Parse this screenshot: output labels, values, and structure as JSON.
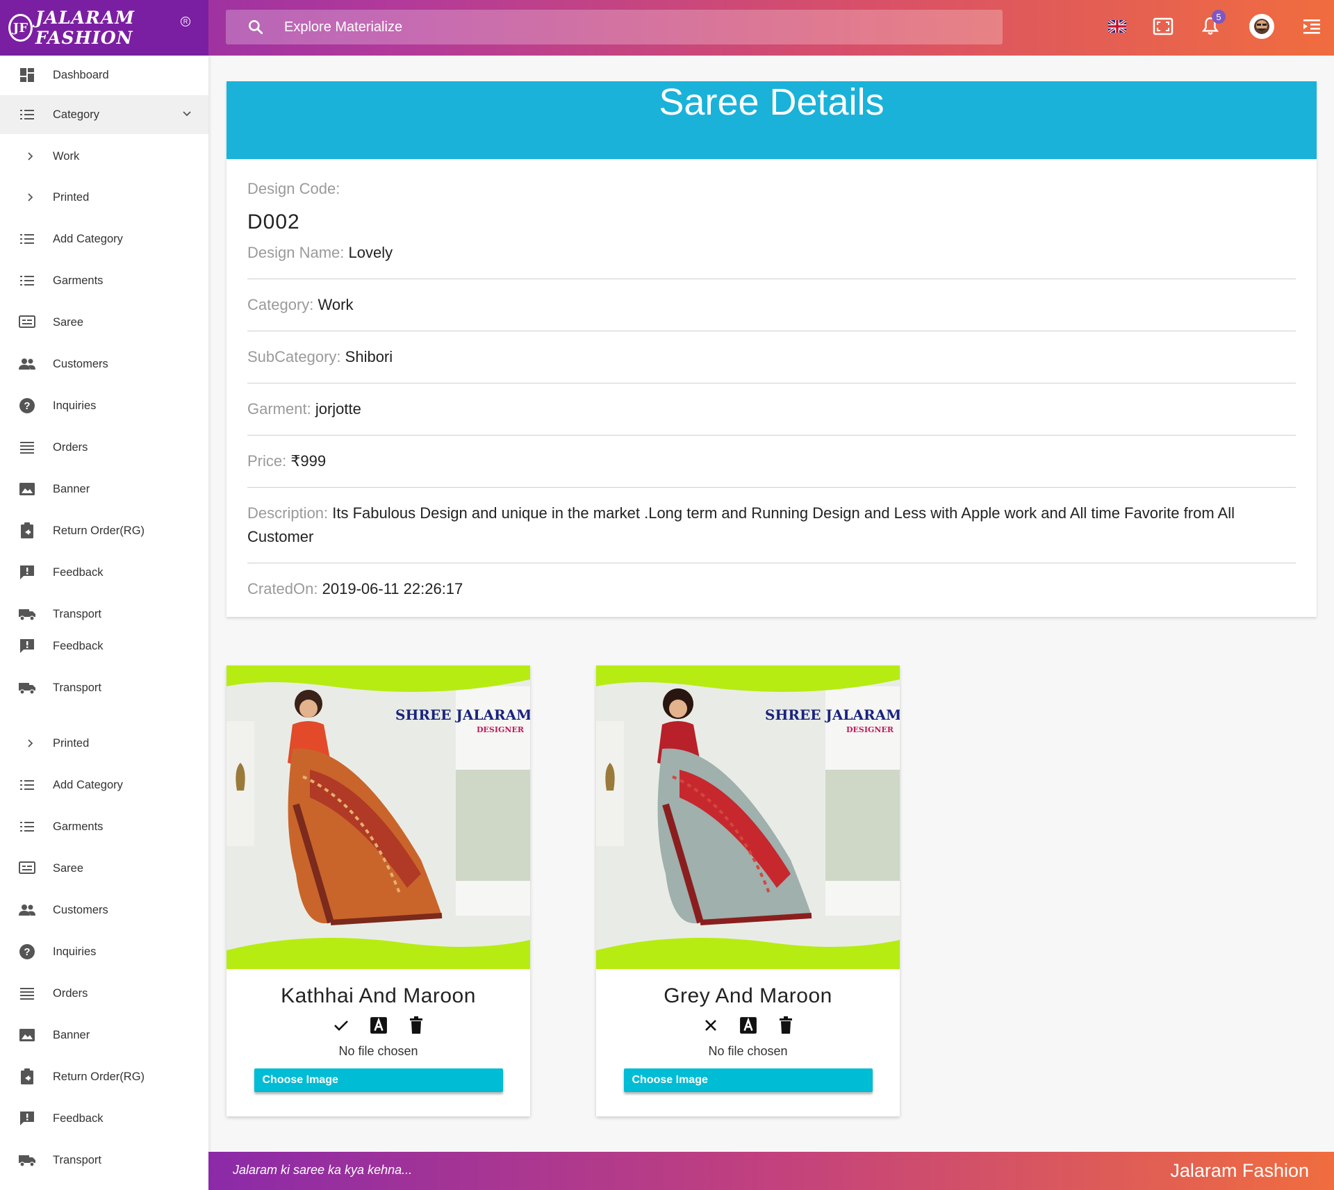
{
  "header": {
    "logo_badge": "JF",
    "logo_text": "JALARAM FASHION",
    "logo_reg": "R",
    "search_placeholder": "Explore Materialize",
    "notification_count": "5"
  },
  "sidebar": {
    "items": [
      {
        "label": "Dashboard",
        "icon": "dashboard-icon"
      },
      {
        "label": "Category",
        "icon": "list-icon"
      },
      {
        "label": "Work",
        "icon": "chevron-right-icon"
      },
      {
        "label": "Printed",
        "icon": "chevron-right-icon"
      },
      {
        "label": "Add Category",
        "icon": "list-icon"
      },
      {
        "label": "Garments",
        "icon": "list-icon"
      },
      {
        "label": "Saree",
        "icon": "subtitles-icon"
      },
      {
        "label": "Customers",
        "icon": "people-icon"
      },
      {
        "label": "Inquiries",
        "icon": "help-icon"
      },
      {
        "label": "Orders",
        "icon": "lines-icon"
      },
      {
        "label": "Banner",
        "icon": "image-icon"
      },
      {
        "label": "Return Order(RG)",
        "icon": "return-icon"
      },
      {
        "label": "Feedback",
        "icon": "feedback-icon"
      },
      {
        "label": "Transport",
        "icon": "truck-icon"
      },
      {
        "label": "Feedback",
        "icon": "feedback-icon"
      },
      {
        "label": "Transport",
        "icon": "truck-icon"
      },
      {
        "label": "Printed",
        "icon": "chevron-right-icon"
      },
      {
        "label": "Add Category",
        "icon": "list-icon"
      },
      {
        "label": "Garments",
        "icon": "list-icon"
      },
      {
        "label": "Saree",
        "icon": "subtitles-icon"
      },
      {
        "label": "Customers",
        "icon": "people-icon"
      },
      {
        "label": "Inquiries",
        "icon": "help-icon"
      },
      {
        "label": "Orders",
        "icon": "lines-icon"
      },
      {
        "label": "Banner",
        "icon": "image-icon"
      },
      {
        "label": "Return Order(RG)",
        "icon": "return-icon"
      },
      {
        "label": "Feedback",
        "icon": "feedback-icon"
      },
      {
        "label": "Transport",
        "icon": "truck-icon"
      }
    ]
  },
  "details": {
    "title": "Saree Details",
    "design_code_label": "Design Code:",
    "design_code": "D002",
    "design_name_label": "Design Name:",
    "design_name": "Lovely",
    "category_label": "Category:",
    "category": "Work",
    "subcategory_label": "SubCategory:",
    "subcategory": "Shibori",
    "garment_label": "Garment:",
    "garment": "jorjotte",
    "price_label": "Price:",
    "price": "₹999",
    "description_label": "Description:",
    "description": "Its Fabulous Design and unique in the market .Long term and Running Design and Less with Apple work and All time Favorite from All Customer",
    "created_label": "CratedOn:",
    "created": "2019-06-11 22:26:17"
  },
  "products": [
    {
      "title": "Kathhai And Maroon",
      "status_icon": "check-icon",
      "no_file": "No file chosen",
      "button": "Choose Image",
      "brand": "SHREE JALARAM",
      "brand_sub": "DESIGNER"
    },
    {
      "title": "Grey And Maroon",
      "status_icon": "close-icon",
      "no_file": "No file chosen",
      "button": "Choose Image",
      "brand": "SHREE JALARAM",
      "brand_sub": "DESIGNER"
    }
  ],
  "footer": {
    "tagline": "Jalaram ki saree ka kya kehna...",
    "brand": "Jalaram Fashion"
  },
  "colors": {
    "header_start": "#8b2aa8",
    "header_end": "#f06d3f",
    "detail_header": "#1ab2d9",
    "button": "#00bcd4"
  }
}
